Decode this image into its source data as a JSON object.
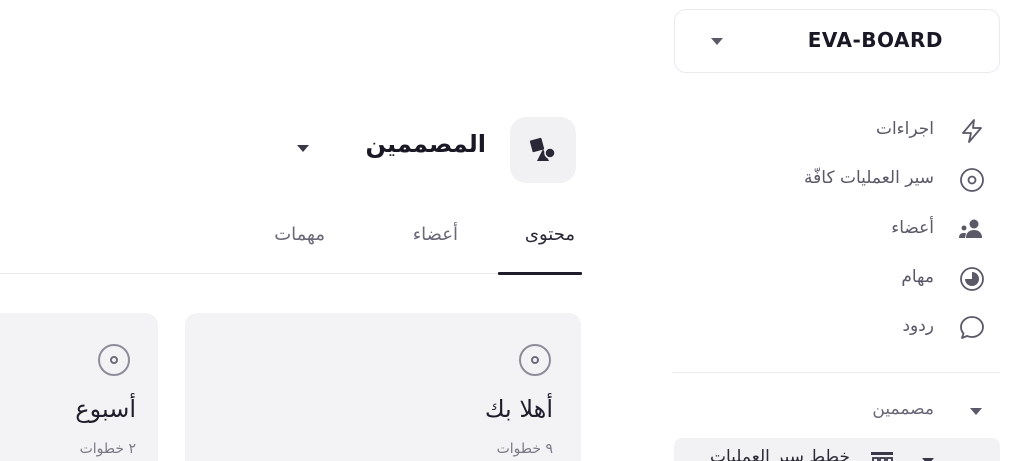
{
  "workspace": {
    "name": "EVA-BOARD"
  },
  "sidebar": {
    "items": [
      {
        "label": "اجراءات",
        "icon": "zap-icon"
      },
      {
        "label": "سير العمليات كافّة",
        "icon": "target-icon"
      },
      {
        "label": "أعضاء",
        "icon": "users-icon"
      },
      {
        "label": "مهام",
        "icon": "pie-icon"
      },
      {
        "label": "ردود",
        "icon": "chat-icon"
      }
    ],
    "group": {
      "label": "مصممين"
    },
    "sub_item": {
      "label": "خطط سير العمليات",
      "icon": "kanban-icon"
    }
  },
  "team": {
    "name": "المصممين"
  },
  "tabs": [
    {
      "label": "محتوى",
      "active": true
    },
    {
      "label": "أعضاء",
      "active": false
    },
    {
      "label": "مهمات",
      "active": false
    }
  ],
  "cards": [
    {
      "title": "أهلا بك",
      "subtitle": "٩ خطوات"
    },
    {
      "title": "أسبوع",
      "subtitle": "٢ خطوات"
    }
  ]
}
